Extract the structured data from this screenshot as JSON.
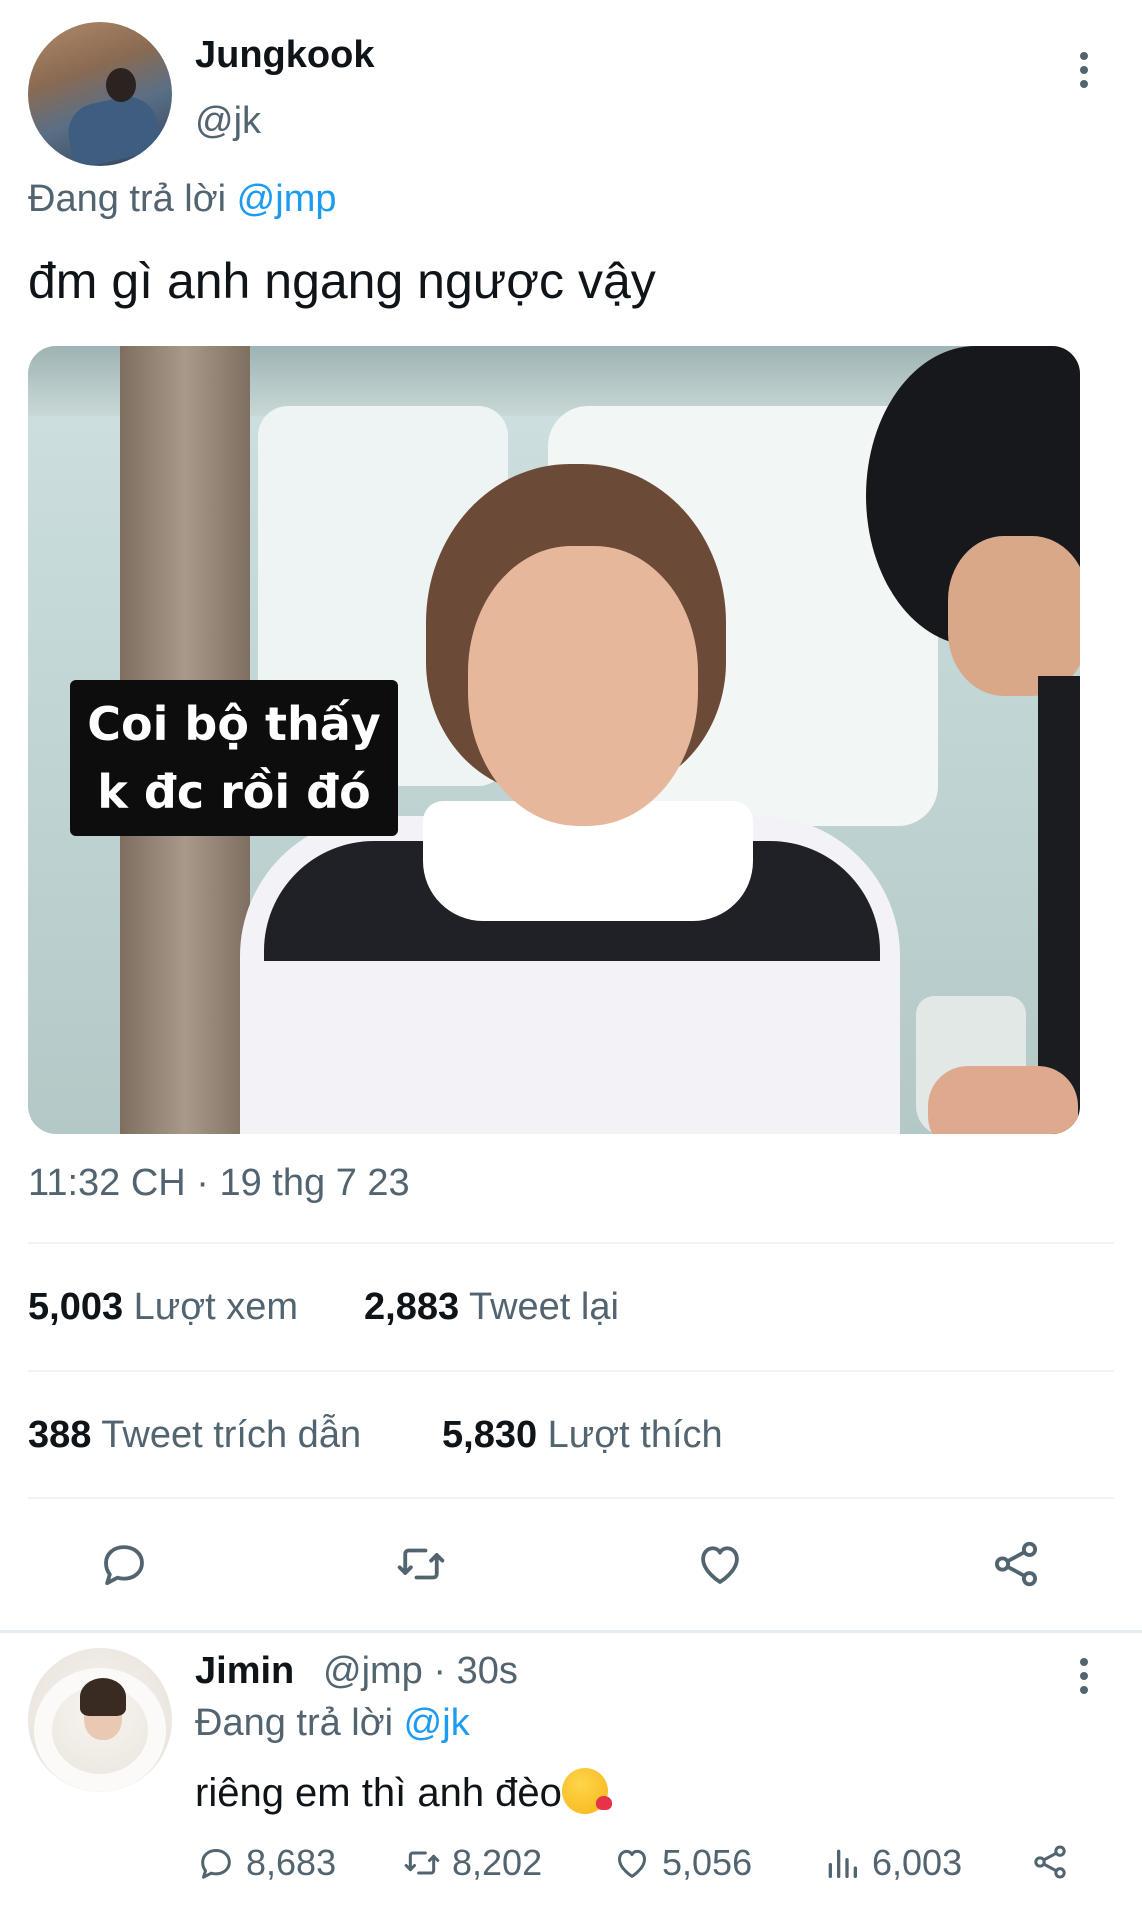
{
  "main_tweet": {
    "display_name": "Jungkook",
    "handle": "@jk",
    "reply_prefix": "Đang trả lời",
    "reply_to": "@jmp",
    "text": "đm gì anh ngang ngược vậy",
    "media_caption": [
      "Coi bộ thấy",
      "k đc rồi đó"
    ],
    "timestamp": "11:32 CH · 19 thg 7 23",
    "stats": {
      "views_count": "5,003",
      "views_label": "Lượt xem",
      "retweets_count": "2,883",
      "retweets_label": "Tweet lại",
      "quotes_count": "388",
      "quotes_label": "Tweet trích dẫn",
      "likes_count": "5,830",
      "likes_label": "Lượt thích"
    },
    "actions": [
      "reply-icon",
      "retweet-icon",
      "like-icon",
      "share-icon"
    ]
  },
  "reply_tweet": {
    "display_name": "Jimin",
    "meta": "@jmp · 30s",
    "reply_prefix": "Đang trả lời",
    "reply_to": "@jk",
    "text": "riêng em thì anh đèo",
    "emoji": "kissing-face-with-heart-icon",
    "actions": {
      "replies": "8,683",
      "retweets": "8,202",
      "likes": "5,056",
      "views": "6,003"
    }
  },
  "colors": {
    "accent": "#1d9bf0",
    "secondary_text": "#536471",
    "primary_text": "#0f1419",
    "divider": "#eff3f4"
  }
}
